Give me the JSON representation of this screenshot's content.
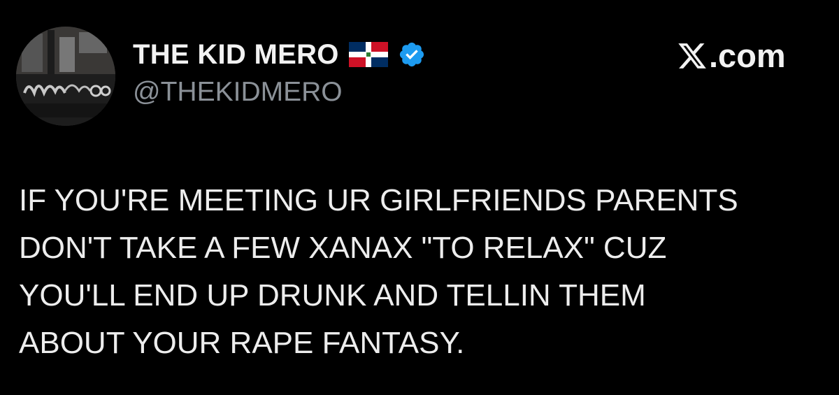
{
  "author": {
    "display_name": "THE KID MERO",
    "handle": "@THEKIDMERO",
    "verified": true,
    "avatar_icon": "graffiti-avatar-icon",
    "flag_icon": "dominican-republic-flag-icon"
  },
  "source": {
    "logo_icon": "x-logo-icon",
    "domain_text": ".com"
  },
  "tweet": {
    "lines": [
      "IF YOU'RE MEETING UR GIRLFRIENDS PARENTS",
      "DON'T TAKE A FEW XANAX \"TO RELAX\" CUZ",
      "YOU'LL END UP DRUNK AND TELLIN THEM",
      "ABOUT YOUR RAPE FANTASY."
    ]
  },
  "colors": {
    "background": "#000000",
    "text_primary": "#e7e9ea",
    "text_secondary": "#8b9198",
    "verified_blue": "#1d9bf0"
  }
}
